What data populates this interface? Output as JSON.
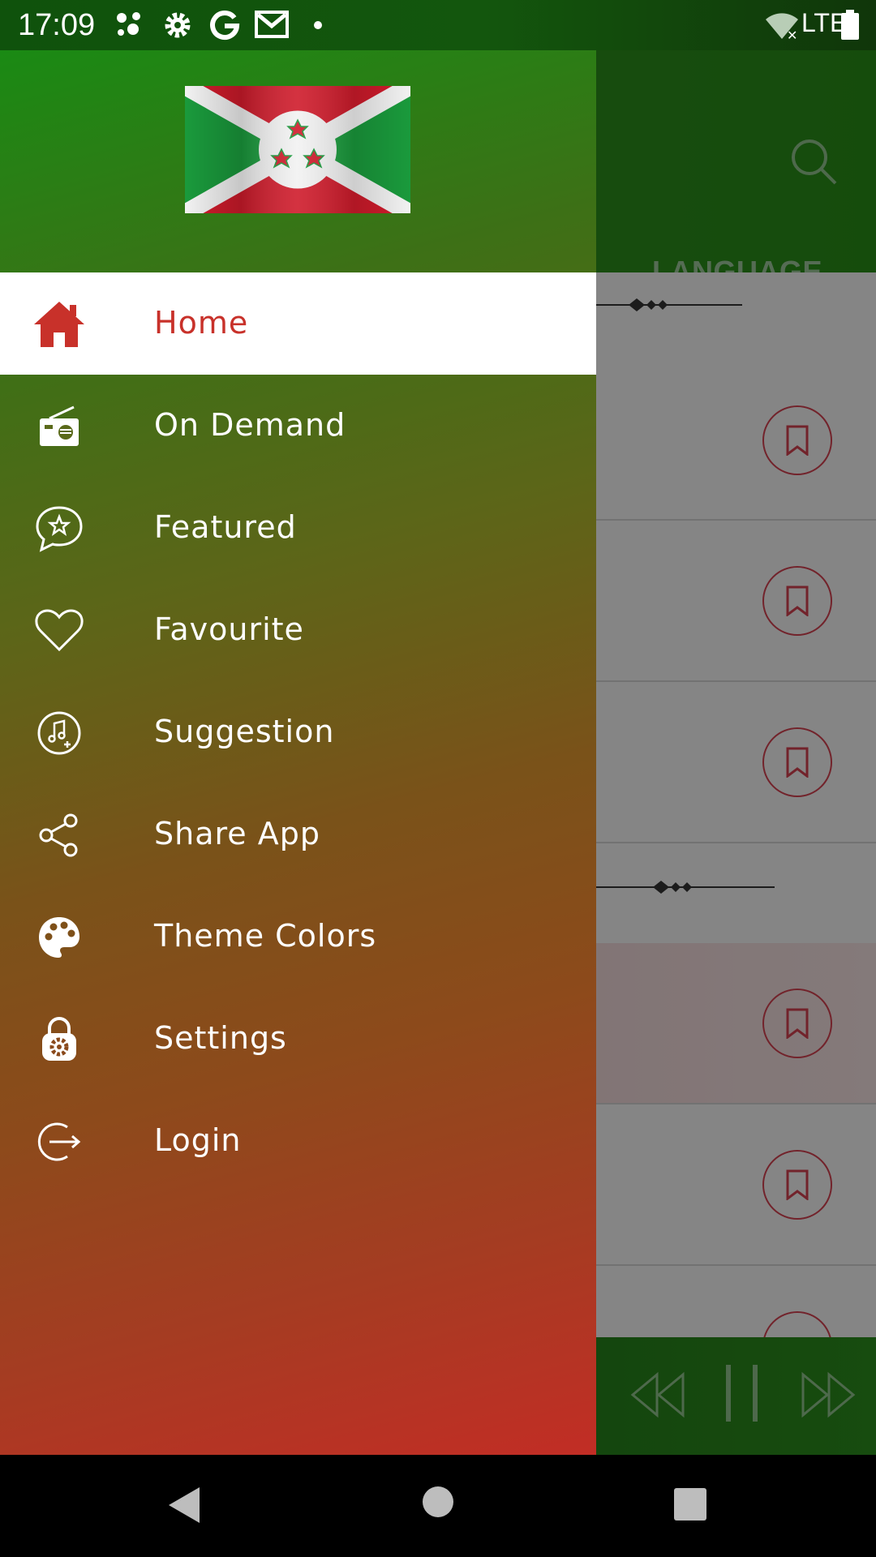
{
  "status_bar": {
    "time": "17:09",
    "network": "LTE",
    "icons": [
      "assistant-icon",
      "gear-icon",
      "google-icon",
      "gmail-icon",
      "dot-icon",
      "wifi-icon",
      "battery-icon"
    ]
  },
  "app": {
    "tab_label": "LANGUAGE",
    "accent": "#d0404f"
  },
  "drawer": {
    "header_image": "burundi-flag",
    "items": [
      {
        "label": "Home",
        "icon": "home-icon",
        "active": true
      },
      {
        "label": "On Demand",
        "icon": "radio-icon"
      },
      {
        "label": "Featured",
        "icon": "star-chat-icon"
      },
      {
        "label": "Favourite",
        "icon": "heart-icon"
      },
      {
        "label": "Suggestion",
        "icon": "music-plus-icon"
      },
      {
        "label": "Share App",
        "icon": "share-icon"
      },
      {
        "label": "Theme Colors",
        "icon": "palette-icon"
      },
      {
        "label": "Settings",
        "icon": "lock-gear-icon"
      },
      {
        "label": "Login",
        "icon": "login-icon"
      }
    ],
    "colors": {
      "top": "#1a8a14",
      "bottom": "#c22d25",
      "active_text": "#c8312a"
    }
  },
  "system_nav": {
    "buttons": [
      "back-icon",
      "home-circle-icon",
      "recents-icon"
    ]
  }
}
